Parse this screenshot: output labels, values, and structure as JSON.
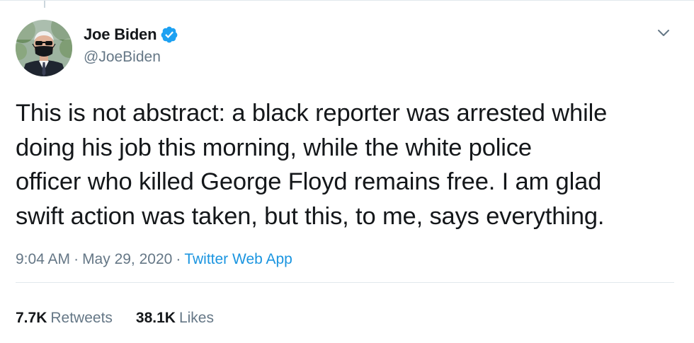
{
  "author": {
    "display_name": "Joe Biden",
    "handle": "@JoeBiden",
    "verified": true,
    "avatar_icon": "profile-photo-masked-man"
  },
  "tweet": {
    "text": "This is not abstract: a black reporter was arrested while\ndoing his job this morning, while the white police\nofficer who killed George Floyd remains free. I am glad\nswift action was taken, but this, to me, says everything."
  },
  "meta": {
    "time": "9:04 AM",
    "separator": "·",
    "date": "May 29, 2020",
    "source": "Twitter Web App"
  },
  "stats": {
    "retweets_count": "7.7K",
    "retweets_label": "Retweets",
    "likes_count": "38.1K",
    "likes_label": "Likes"
  },
  "colors": {
    "text_primary": "#14171a",
    "text_secondary": "#657786",
    "link": "#1b95e0",
    "verified": "#1da1f2",
    "divider": "#e1e8ed"
  },
  "icons": {
    "verified": "verified-badge-icon",
    "menu": "chevron-down-icon"
  }
}
